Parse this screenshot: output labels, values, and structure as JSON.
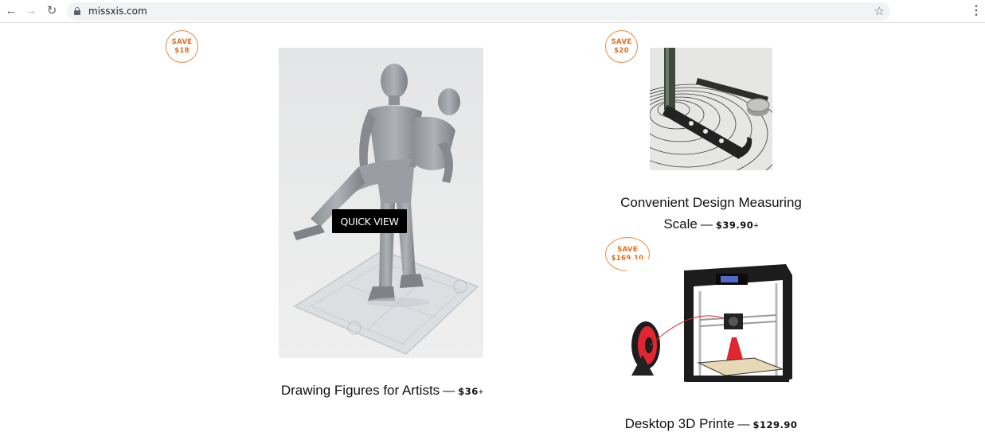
{
  "browser": {
    "url": "missxis.com",
    "back_icon": "arrow-left-icon",
    "forward_icon": "arrow-right-icon",
    "reload_icon": "reload-icon",
    "bookmark_icon": "star-icon",
    "menu_icon": "kebab-menu-icon"
  },
  "products": [
    {
      "save_line1": "SAVE",
      "save_line2": "$18",
      "title": "Drawing Figures for Artists",
      "dash": "—",
      "price": "$36",
      "price_suffix": "+",
      "quick_view": "QUICK VIEW"
    },
    {
      "save_line1": "SAVE",
      "save_line2": "$20",
      "title_line1": "Convenient Design Measuring",
      "title_line2": "Scale",
      "dash": "—",
      "price": "$39.90",
      "price_suffix": "+"
    },
    {
      "save_line1": "SAVE",
      "save_line2": "$169.10",
      "title": "Desktop 3D Printe",
      "dash": "—",
      "price": "$129.90"
    }
  ],
  "colors": {
    "badge_border": "#e58b3f",
    "badge_text": "#e06d1f",
    "quick_view_bg": "#000000",
    "quick_view_text": "#ffffff"
  }
}
